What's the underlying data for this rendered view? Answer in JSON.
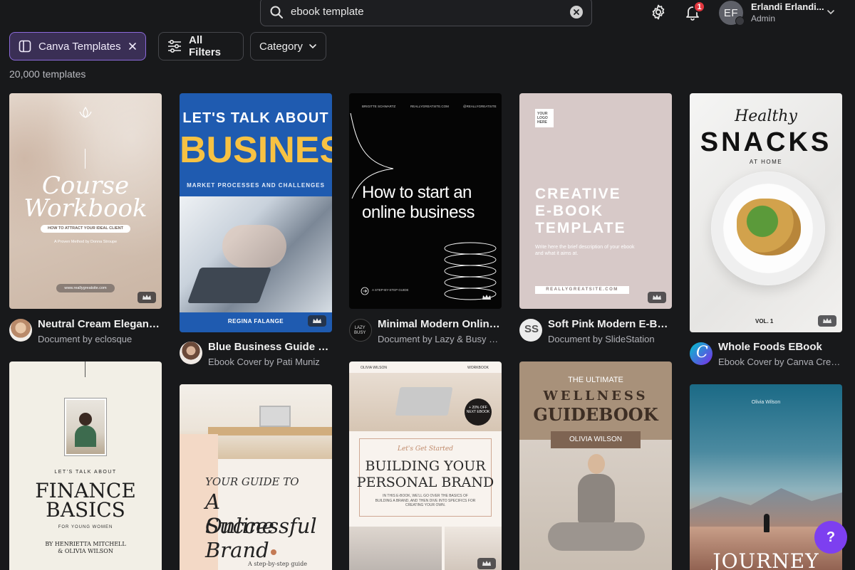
{
  "search": {
    "value": "ebook template"
  },
  "header": {
    "notifications_count": "1",
    "avatar_initials": "EF",
    "user_name": "Erlandi Erlandi...",
    "user_role": "Admin"
  },
  "filters": {
    "canva_templates": "Canva Templates",
    "all_filters": "All Filters",
    "category": "Category"
  },
  "results_count": "20,000 templates",
  "colors": {
    "accent": "#8b6ad9",
    "help": "#7d3ff0",
    "badge": "#e2373f"
  },
  "cards": [
    {
      "title": "Neutral Cream Elegant ...",
      "subtitle": "Document by eclosque",
      "cover": {
        "title_a": "Course",
        "title_b": "Workbook",
        "strap": "HOW TO ATTRACT YOUR IDEAL CLIENT",
        "line": "A Proven Method by Donna Stroupe",
        "url": "www.reallygreatsite.com"
      }
    },
    {
      "title": "Blue Business Guide Eb...",
      "subtitle": "Ebook Cover by Pati Muniz",
      "cover": {
        "kicker": "LET'S TALK ABOUT",
        "headline": "BUSINESS",
        "sub": "MARKET PROCESSES AND CHALLENGES",
        "author": "REGINA FALANGE"
      }
    },
    {
      "title": "Minimal Modern Online ...",
      "subtitle": "Document by Lazy & Busy Lab",
      "cover": {
        "top_left": "BRIGITTE SCHWARTZ",
        "top_mid": "REALLYGREATSITE.COM",
        "top_right": "@REALLYGREATSITE",
        "line1": "How to start an",
        "line2": "online business",
        "foot": "A STEP-BY-STEP GUIDE"
      }
    },
    {
      "title": "Soft Pink Modern E-Boo...",
      "subtitle": "Document by SlideStation",
      "cover": {
        "logo": "YOUR LOGO HERE",
        "line1": "CREATIVE",
        "line2": "E-BOOK",
        "line3": "TEMPLATE",
        "desc": "Write here the brief description of your ebook and what it aims at.",
        "url": "REALLYGREATSITE.COM"
      }
    },
    {
      "title": "Whole Foods EBook",
      "subtitle": "Ebook Cover by Canva Creat...",
      "cover": {
        "script": "Healthy",
        "headline": "SNACKS",
        "sub": "AT HOME",
        "vol": "VOL. 1"
      }
    },
    {
      "cover": {
        "kicker": "LET'S TALK ABOUT",
        "line1": "FINANCE",
        "line2": "BASICS",
        "sub": "FOR YOUNG WOMEN",
        "authors_a": "BY HENRIETTA MITCHELL",
        "authors_b": "& OLIVIA WILSON"
      }
    },
    {
      "cover": {
        "line0": "YOUR GUIDE TO",
        "line1": "A Successful",
        "line2": "Online Brand",
        "foot": "A step-by-step guide"
      }
    },
    {
      "cover": {
        "top_left": "OLIVIA WILSON",
        "top_right": "WORKBOOK",
        "badge": "+ 20% OFF NEXT EBOOK",
        "script": "Let's Get Started",
        "line1": "BUILDING YOUR",
        "line2": "PERSONAL BRAND",
        "desc": "IN THIS E-BOOK, WE'LL GO OVER THE BASICS OF BUILDING A BRAND, AND THEN DIVE INTO SPECIFICS FOR CREATING YOUR OWN."
      }
    },
    {
      "cover": {
        "kicker": "THE ULTIMATE",
        "line1": "WELLNESS",
        "line2": "GUIDEBOOK",
        "author": "OLIVIA WILSON"
      }
    },
    {
      "cover": {
        "author": "Olivia Wilson",
        "headline": "JOURNEY"
      }
    }
  ]
}
